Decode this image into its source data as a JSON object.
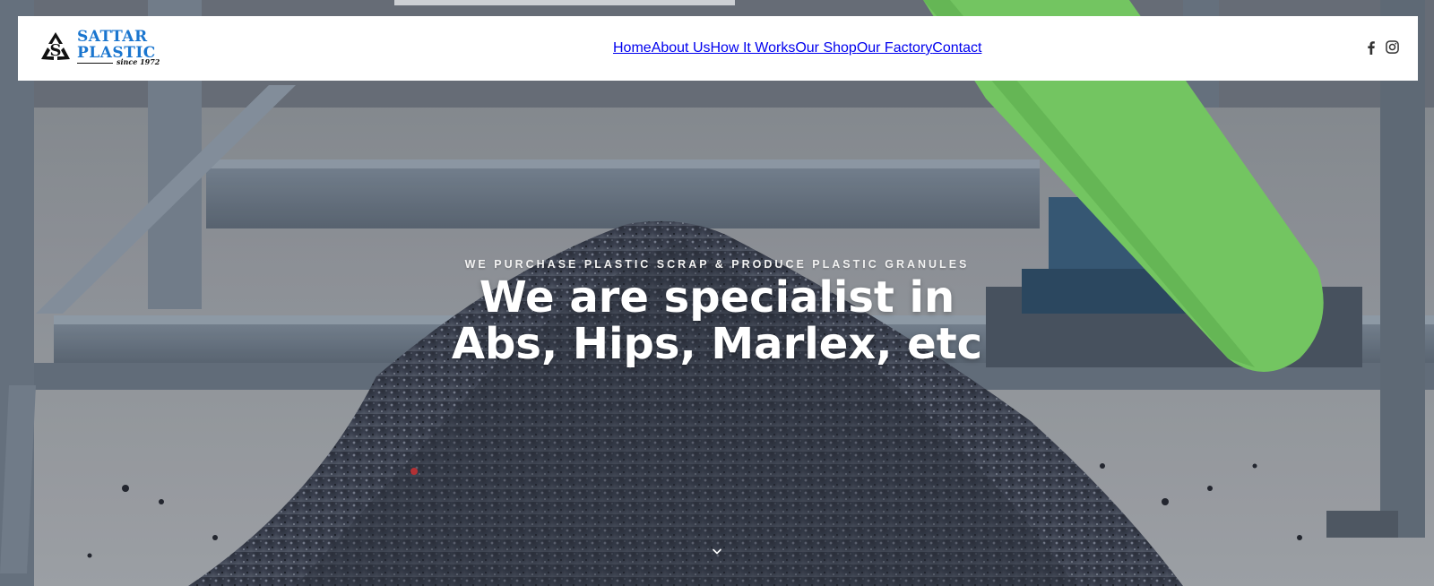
{
  "brand": {
    "name_line1": "SATTAR",
    "name_line2": "PLASTIC",
    "since": "since 1972",
    "brand_color": "#1b76cf",
    "logo_icon": "recycle-s-icon"
  },
  "nav": {
    "items": [
      {
        "label": "Home"
      },
      {
        "label": "About Us"
      },
      {
        "label": "How It Works"
      },
      {
        "label": "Our Shop"
      },
      {
        "label": "Our Factory"
      },
      {
        "label": "Contact"
      }
    ]
  },
  "social": {
    "icons": [
      "facebook-icon",
      "instagram-icon"
    ]
  },
  "hero": {
    "eyebrow": "WE PURCHASE PLASTIC SCRAP & PRODUCE PLASTIC GRANULES",
    "headline_line1": "We are specialist in",
    "headline_line2": "Abs, Hips, Marlex, etc",
    "scroll_icon": "chevron-down-icon",
    "accent_green": "#7dd66a",
    "granule_color": "#3c4150"
  }
}
